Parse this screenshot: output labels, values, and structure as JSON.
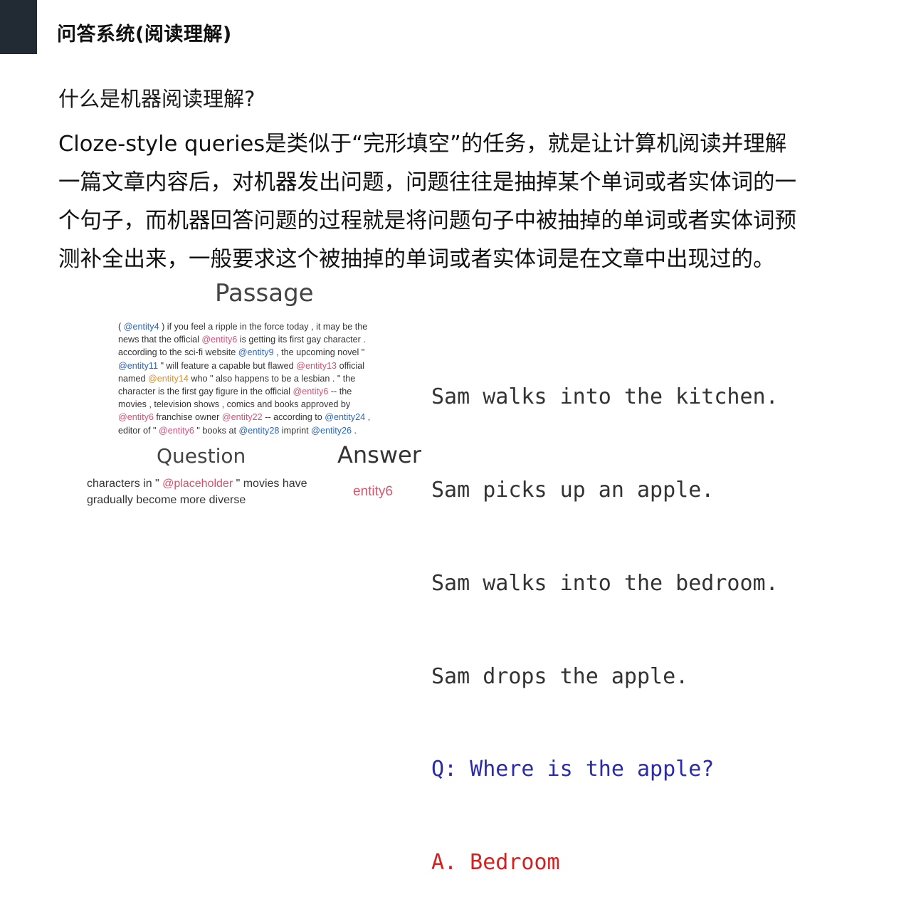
{
  "header": {
    "title": "问答系统(阅读理解)"
  },
  "question_heading": "什么是机器阅读理解?",
  "body_lines": [
    "Cloze-style queries是类似于“完形填空”的任务，就是让计算机阅读并理解",
    "一篇文章内容后，对机器发出问题，问题往往是抽掉某个单词或者实体词的一",
    "个句子，而机器回答问题的过程就是将问题句子中被抽掉的单词或者实体词预",
    "测补全出来，一般要求这个被抽掉的单词或者实体词是在文章中出现过的。"
  ],
  "figure": {
    "passage_title": "Passage",
    "passage": {
      "l1a": "( ",
      "l1e": "@entity4",
      "l1b": " ) if you feel a ripple in the force today , it may be the",
      "l2a": "news that the official ",
      "l2e": "@entity6",
      "l2b": " is getting its first gay character .",
      "l3a": "according to the sci-fi website ",
      "l3e": "@entity9",
      "l3b": " , the upcoming novel \"",
      "l4e1": "@entity11",
      "l4a": " \" will feature a capable but flawed ",
      "l4e2": "@entity13",
      "l4b": " official",
      "l5a": "named ",
      "l5e": "@entity14",
      "l5b": " who \" also happens to be a lesbian . \" the",
      "l6a": "character is the first gay figure in the official ",
      "l6e": "@entity6",
      "l6b": " -- the",
      "l7": "movies , television shows , comics and books approved by",
      "l8e1": "@entity6",
      "l8a": " franchise owner ",
      "l8e2": "@entity22",
      "l8b": " -- according to ",
      "l8e3": "@entity24",
      "l8c": " ,",
      "l9a": "editor of \" ",
      "l9e1": "@entity6",
      "l9b": " \" books at ",
      "l9e2": "@entity28",
      "l9c": " imprint ",
      "l9e3": "@entity26",
      "l9d": " ."
    },
    "question_title": "Question",
    "question": {
      "q1a": "characters in \" ",
      "q1p": "@placeholder",
      "q1b": " \" movies have",
      "q2": "gradually become more diverse"
    },
    "answer_title": "Answer",
    "answer": "entity6"
  },
  "babi": {
    "lines": [
      "Sam walks into the kitchen.",
      "Sam picks up an apple.",
      "Sam walks into the bedroom.",
      "Sam drops the apple."
    ],
    "question": "Q: Where is the apple?",
    "answer": "A. Bedroom"
  },
  "colors": {
    "entity_blue": "#2c67b8",
    "entity_orange": "#d9922a",
    "entity_pink": "#d9507a",
    "babi_question": "#2b2ba8",
    "babi_answer": "#d52020"
  }
}
